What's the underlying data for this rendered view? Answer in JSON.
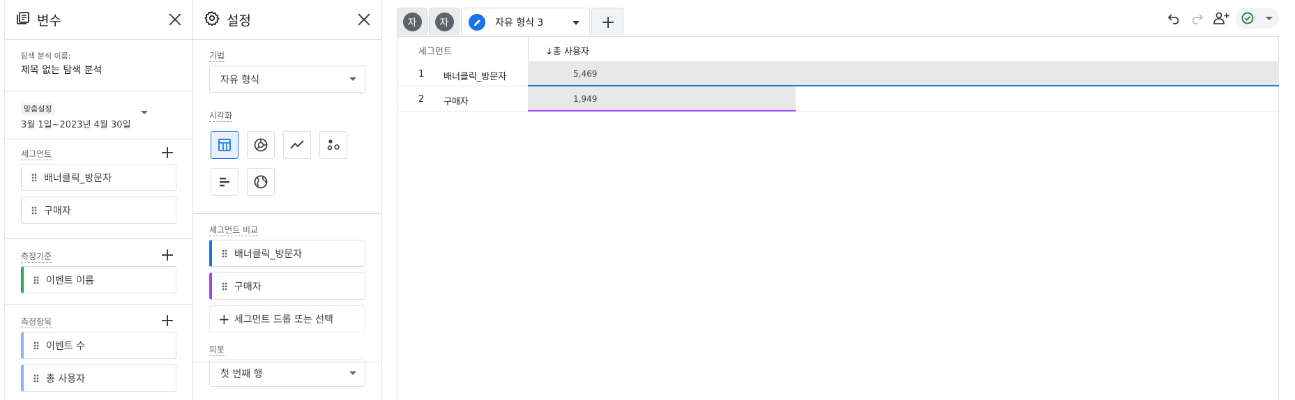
{
  "variables_panel": {
    "title": "변수",
    "explore_name_label": "탐색 분석 이름:",
    "explore_name_value": "제목 없는 탐색 분석",
    "date": {
      "badge": "맞춤설정",
      "range": "3월 1일~2023년 4월 30일"
    },
    "segments": {
      "label": "세그먼트",
      "items": [
        "배너클릭_방문자",
        "구매자"
      ]
    },
    "dimensions": {
      "label": "측정기준",
      "items": [
        "이벤트 이름"
      ]
    },
    "metrics": {
      "label": "측정항목",
      "items": [
        "이벤트 수",
        "총 사용자"
      ]
    }
  },
  "settings_panel": {
    "title": "설정",
    "technique": {
      "label": "기법",
      "value": "자유 형식"
    },
    "visualization": {
      "label": "시각화",
      "selected": "table",
      "icons": [
        "table-icon",
        "donut-chart-icon",
        "line-chart-icon",
        "scatter-icon",
        "bar-chart-icon",
        "globe-icon"
      ]
    },
    "segment_compare": {
      "label": "세그먼트 비교",
      "items": [
        "배너클릭_방문자",
        "구매자"
      ],
      "drop_hint": "세그먼트 드롭 또는 선택"
    },
    "pivot": {
      "label": "피봇",
      "value": "첫 번째 행"
    }
  },
  "tabs": {
    "mini_tabs": [
      "자",
      "자"
    ],
    "active_tab": "자유 형식 3"
  },
  "colors": {
    "accent": "#1a73e8",
    "purple": "#a142f4",
    "green": "#34a853",
    "light_blue": "#8ab4f8"
  },
  "table": {
    "headers": {
      "segment": "세그먼트",
      "metric": "↓총 사용자"
    },
    "rows": [
      {
        "index": "1",
        "name": "배너클릭_방문자",
        "value": "5,469",
        "fraction": 1.0,
        "color": "#1a73e8"
      },
      {
        "index": "2",
        "name": "구매자",
        "value": "1,949",
        "fraction": 0.3564,
        "color": "#a142f4"
      }
    ]
  }
}
